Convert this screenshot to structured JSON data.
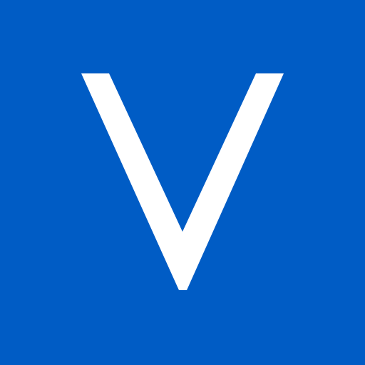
{
  "app_icon": {
    "letter": "V",
    "background_color": "#005cc5",
    "glyph_color": "#ffffff"
  }
}
